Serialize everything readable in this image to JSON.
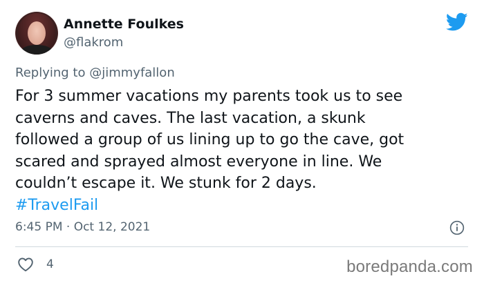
{
  "author": {
    "display_name": "Annette Foulkes",
    "handle": "@flakrom",
    "avatar_icon": "profile-photo"
  },
  "platform_icon": "twitter-bird-icon",
  "reply": {
    "prefix": "Replying to",
    "mention": "@jimmyfallon"
  },
  "body": {
    "lines": [
      "For 3 summer vacations my parents took us to see",
      "caverns and caves.  The last vacation, a skunk",
      "followed a group of us lining up to go the cave, got",
      "scared and sprayed almost everyone in line.  We",
      "couldn’t escape it.  We stunk for 2 days."
    ],
    "hashtag": "#TravelFail"
  },
  "timestamp": "6:45 PM · Oct 12, 2021",
  "engagement": {
    "likes": "4"
  },
  "watermark": "boredpanda.com",
  "colors": {
    "text": "#0f1419",
    "muted": "#536471",
    "accent": "#1d9bf0",
    "divider": "#cfd9de"
  }
}
